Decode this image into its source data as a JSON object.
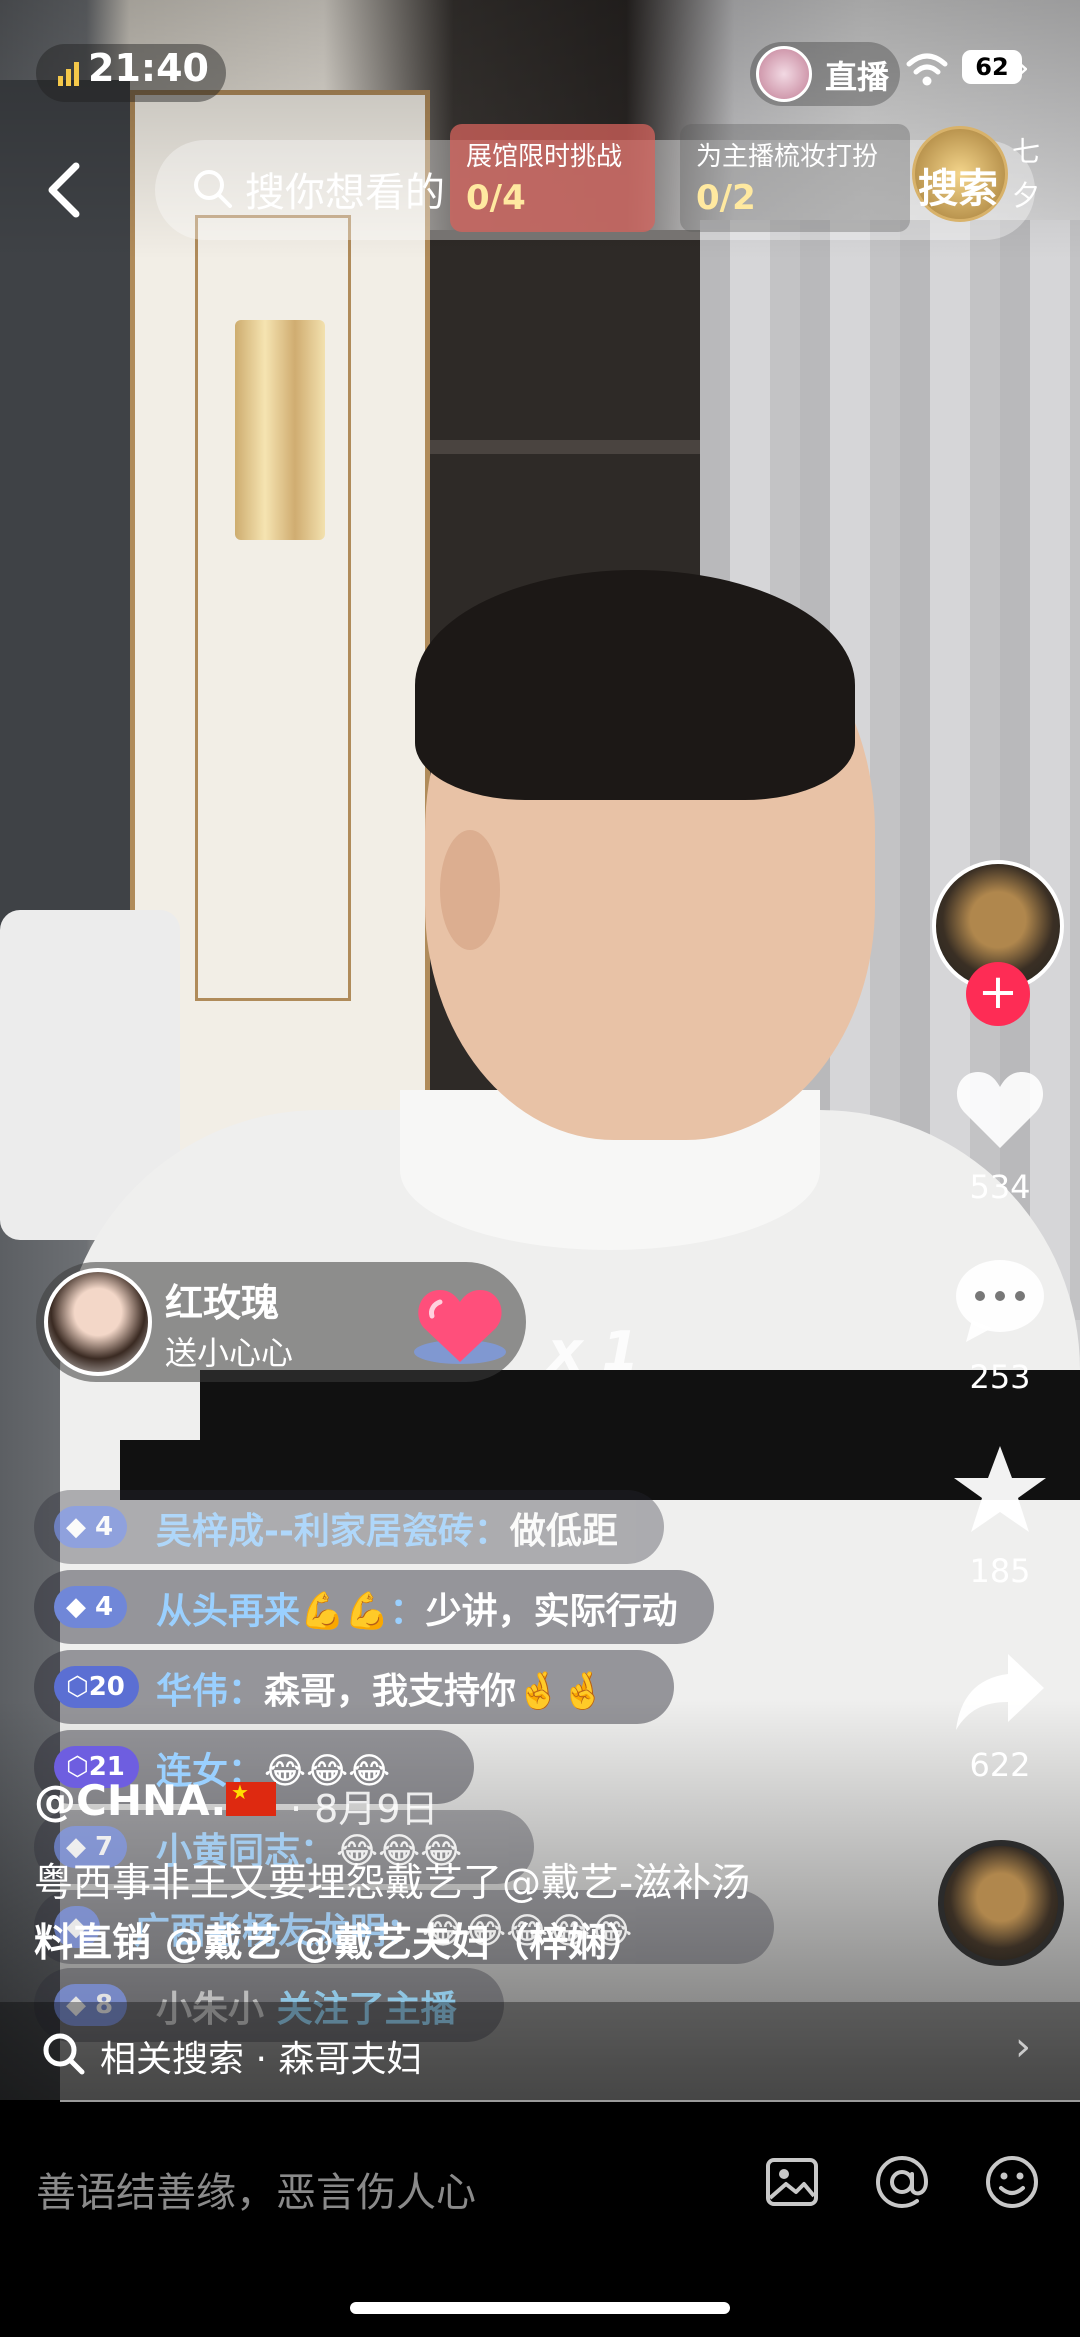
{
  "status_bar": {
    "time": "21:40",
    "host_label": "直播",
    "battery": "62"
  },
  "header": {
    "search_placeholder": "搜你想看的",
    "challenges": [
      {
        "title": "展馆限时挑战",
        "value": "0/4"
      },
      {
        "title": "为主播梳妆打扮",
        "value": "0/2"
      }
    ],
    "search_button": "搜索",
    "side_text": "七夕"
  },
  "rail": {
    "like_count": "534",
    "comment_count": "253",
    "favorite_count": "185",
    "share_count": "622",
    "follow_symbol": "+"
  },
  "gift": {
    "user": "红玫瑰",
    "action": "送小心心",
    "count": "x 1"
  },
  "comments": [
    {
      "level": "4",
      "user": "吴梓成--利家居瓷砖",
      "text": "做低距"
    },
    {
      "level": "4",
      "user": "从头再来💪💪",
      "text": "少讲，实际行动"
    },
    {
      "level": "20",
      "user": "华伟",
      "text": "森哥，我支持你🤞🤞"
    },
    {
      "level": "21",
      "user": "连女",
      "text": "😂😂😂"
    },
    {
      "level": "7",
      "user": "小黄同志",
      "text": "😂😂😂"
    },
    {
      "level": "",
      "user": "广西老杨友龙明",
      "text": "😂😂😂😂😂"
    },
    {
      "level": "8",
      "user": "小朱小",
      "text": "关注了主播"
    }
  ],
  "caption": {
    "user": "@CHNA.",
    "date": "· 8月9日",
    "line1": "粤西事非王又要埋怨戴艺了@戴艺-滋补汤",
    "line2": "料直销 @戴艺 @戴艺夫妇（梓娴）"
  },
  "related": {
    "label": "相关搜索 · 森哥夫妇"
  },
  "bottom": {
    "input_placeholder": "善语结善缘，恶言伤人心"
  },
  "icons": {
    "back": "chevron-left-icon",
    "search": "search-icon",
    "like": "heart-icon",
    "comment": "comment-icon",
    "favorite": "star-icon",
    "share": "share-icon",
    "image": "image-icon",
    "mention": "at-icon",
    "emoji": "emoji-icon"
  },
  "colors": {
    "accent": "#fe2c55",
    "challenge_active": "#d6635c",
    "level_badge": "#7087d8"
  }
}
